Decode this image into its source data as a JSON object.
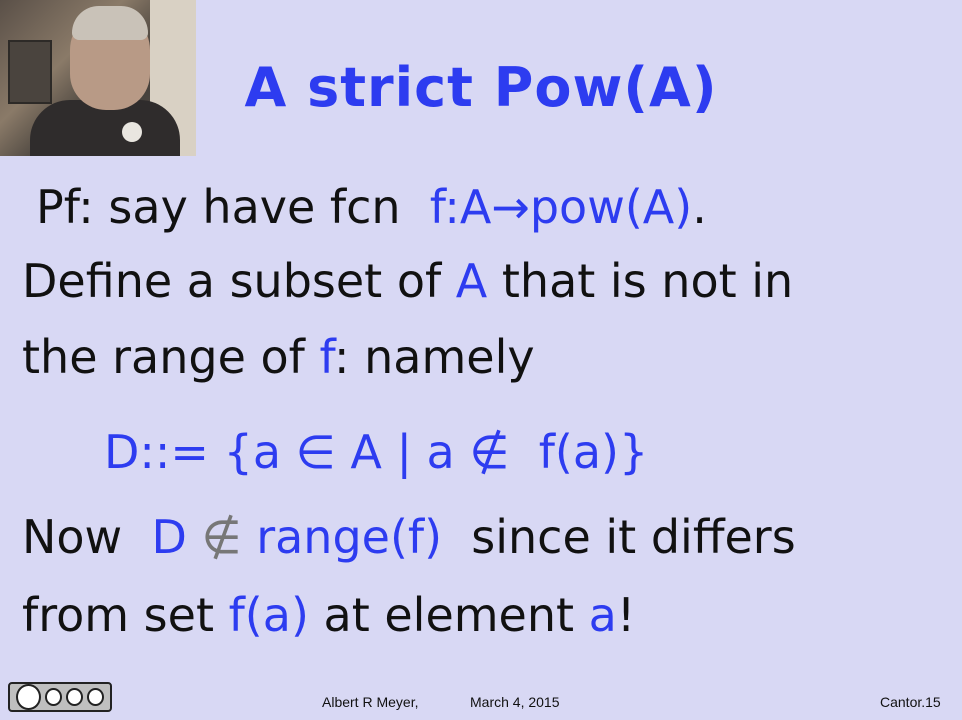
{
  "slide": {
    "title": "A strict Pow(A)",
    "line1_prefix": "Pf: say have fcn",
    "line1_math": "f:A→pow(A)",
    "line1_end": ".",
    "line2_a": "Define a subset of",
    "line2_b": "A",
    "line2_c": "that is not in",
    "line3_a": "the range of",
    "line3_b": "f",
    "line3_c": ": namely",
    "definition_1": "D::= {a ∈ A | a",
    "definition_notin": "∉",
    "definition_2": "f(a)}",
    "line5_a": "Now",
    "line5_b": "D",
    "line5_notin": "∉",
    "line5_c": "range(f)",
    "line5_d": "since it differs",
    "line6_a": "from set",
    "line6_b": "f(a)",
    "line6_c": "at element",
    "line6_d": "a",
    "line6_e": "!"
  },
  "footer": {
    "author": "Albert R Meyer,",
    "date": "March 4, 2015",
    "slide_id": "Cantor.15",
    "license": "cc by nc sa"
  },
  "colors": {
    "accent": "#2d3cf0",
    "background": "#d8d8f4"
  }
}
